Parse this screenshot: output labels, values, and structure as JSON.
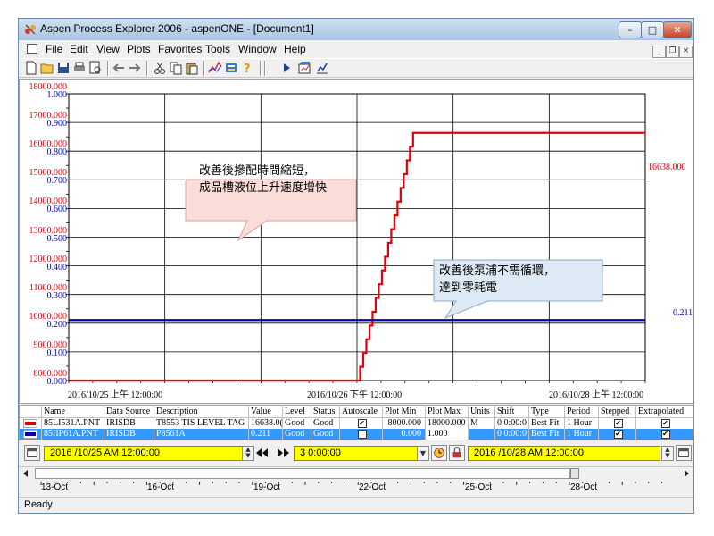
{
  "window": {
    "title": "Aspen Process Explorer 2006 - aspenONE - [Document1]",
    "controls": {
      "minimize": "–",
      "maximize": "□",
      "close": "✕"
    },
    "mdi_controls": {
      "minimize": "_",
      "restore": "❐",
      "close": "×"
    }
  },
  "menu": {
    "items": [
      "File",
      "Edit",
      "View",
      "Plots",
      "Favorites",
      "Tools",
      "Window",
      "Help"
    ]
  },
  "toolbar": {
    "icons": [
      "new-icon",
      "open-icon",
      "save-icon",
      "print-icon",
      "print-preview-icon",
      "back-arrow-icon",
      "forward-arrow-icon",
      "cut-icon",
      "copy-icon",
      "paste-icon",
      "trend-icon",
      "legend-icon",
      "help-icon",
      "play-icon",
      "chart-icon",
      "edit-chart-icon"
    ]
  },
  "plot": {
    "left_axis_red": [
      "18000.000",
      "17000.000",
      "16000.000",
      "15000.000",
      "14000.000",
      "13000.000",
      "12000.000",
      "11000.000",
      "10000.000",
      "9000.000",
      "8000.000"
    ],
    "left_axis_blue": [
      "1.000",
      "0.900",
      "0.800",
      "0.700",
      "0.600",
      "0.500",
      "0.400",
      "0.300",
      "0.200",
      "0.100",
      "0.000"
    ],
    "x_labels": [
      "2016/10/25 上午 12:00:00",
      "2016/10/26 下午 12:00:00",
      "2016/10/28 上午 12:00:00"
    ],
    "red_end_value": "16638.000",
    "blue_end_value": "0.211",
    "callouts": [
      {
        "line1": "改善後摻配時間縮短，",
        "line2": "成品槽液位上升速度增快"
      },
      {
        "line1": "改善後泵浦不需循環，",
        "line2": "達到零耗電"
      }
    ],
    "colors": {
      "red": "#e0000b",
      "blue": "#0000aa",
      "callout1_fill": "#fadcd8",
      "callout2_fill": "#dde9f5"
    }
  },
  "chart_data": {
    "type": "line",
    "x_range": [
      "2016/10/25 00:00",
      "2016/10/28 00:00"
    ],
    "series": [
      {
        "name": "85LI531A.PNT",
        "color": "#e0000b",
        "unit": "M",
        "ylim": [
          8000,
          18000
        ],
        "points": [
          [
            "2016/10/25 00:00",
            8000
          ],
          [
            "2016/10/26 12:00",
            8000
          ],
          [
            "2016/10/26 19:00",
            16638
          ],
          [
            "2016/10/28 00:00",
            16638
          ]
        ]
      },
      {
        "name": "85II P61A.PNT",
        "color": "#0000aa",
        "unit": "",
        "ylim": [
          0,
          1
        ],
        "points": [
          [
            "2016/10/25 00:00",
            0.211
          ],
          [
            "2016/10/28 00:00",
            0.211
          ]
        ]
      }
    ],
    "grid": true
  },
  "table": {
    "headers": [
      "Name",
      "Data Source",
      "Description",
      "Value",
      "Level",
      "Status",
      "Autoscale",
      "Plot Min",
      "Plot Max",
      "Units",
      "Shift",
      "Type",
      "Period",
      "Stepped",
      "Extrapolated"
    ],
    "rows": [
      {
        "color": "#e0000b",
        "name": "85LI531A.PNT",
        "source": "IRISDB",
        "desc": "T8553 TIS LEVEL TAG",
        "value": "16638.0(",
        "level": "Good",
        "status": "Good",
        "autoscale": "✔",
        "min": "8000.000",
        "max": "18000.000",
        "units": "M",
        "shift": "0  0:00:0",
        "type": "Best Fit",
        "period": "1 Hour",
        "stepped": "✔",
        "extrap": "✔"
      },
      {
        "color": "#0000aa",
        "name": "85IIP61A.PNT",
        "source": "IRISDB",
        "desc": "P8561A",
        "value": "0.211",
        "level": "Good",
        "status": "Good",
        "autoscale": "",
        "min": "0.000",
        "max": "1.000",
        "units": "",
        "shift": "0  0:00:0",
        "type": "Best Fit",
        "period": "1 Hour",
        "stepped": "✔",
        "extrap": "✔"
      }
    ]
  },
  "timebar": {
    "start": "2016 /10/25   AM  12:00:00",
    "duration": "3 0:00:00",
    "end": "2016 /10/28   AM  12:00:00"
  },
  "timeline": {
    "labels": [
      "13-Oct",
      "16-Oct",
      "19-Oct",
      "22-Oct",
      "25-Oct",
      "28-Oct"
    ]
  },
  "status": {
    "text": "Ready"
  }
}
